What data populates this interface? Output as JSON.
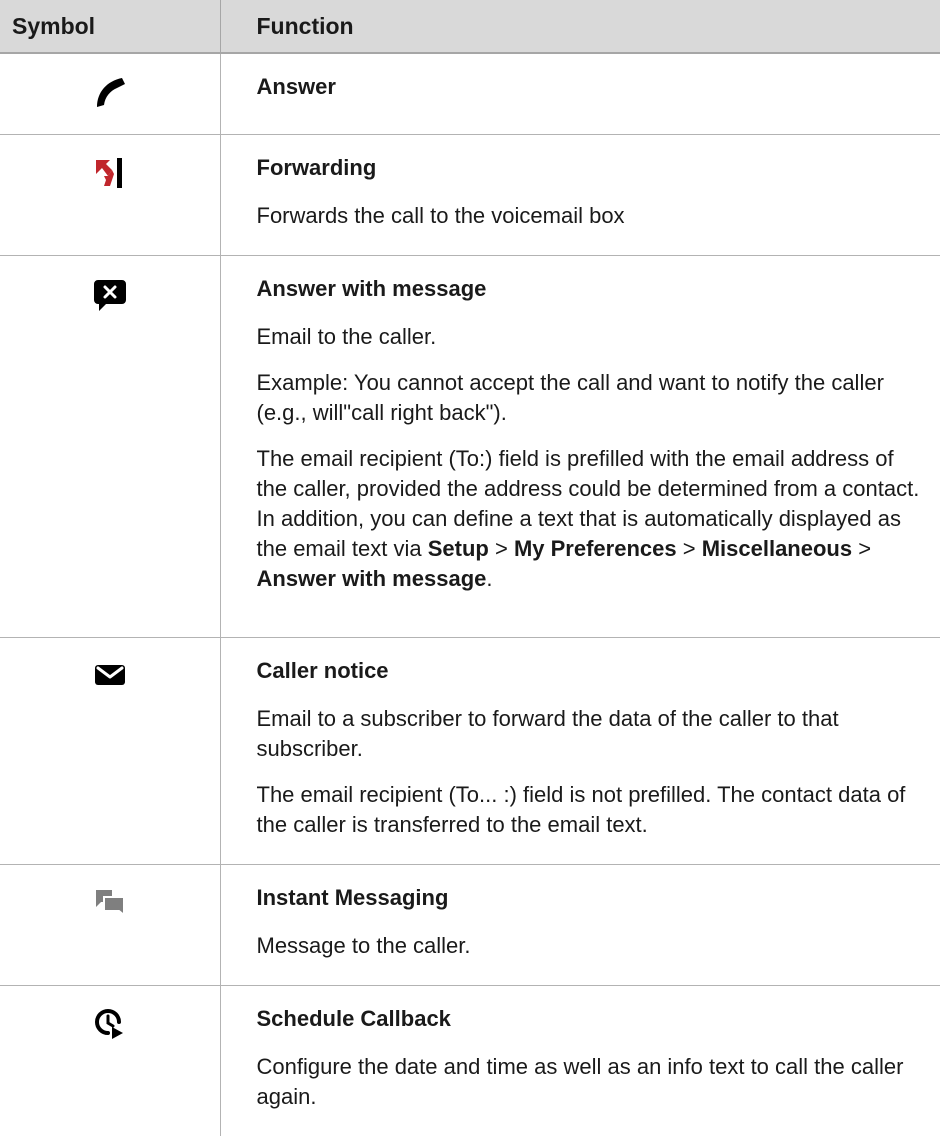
{
  "header": {
    "symbol": "Symbol",
    "function": "Function"
  },
  "rows": [
    {
      "icon": "phone-handset-icon",
      "title": "Answer"
    },
    {
      "icon": "forward-to-voicemail-icon",
      "title": "Forwarding",
      "p1": "Forwards the call to the voicemail box"
    },
    {
      "icon": "chat-bubble-x-icon",
      "title": "Answer with message",
      "p1": "Email to the caller.",
      "p2": "Example: You cannot accept the call and want to notify the caller (e.g., will\"call right back\").",
      "p3": "The email recipient (To:) field is prefilled with the email address of the caller, provided the address could be determined from a contact. In addition, you can define a text that is automatically displayed as the email text via",
      "menu": [
        "Setup",
        "My Preferences",
        "Miscellaneous",
        "Answer with message"
      ],
      "sep": ">",
      "end": "."
    },
    {
      "icon": "envelope-icon",
      "title": "Caller notice",
      "p1": "Email to a subscriber to forward the data of the caller to that subscriber.",
      "p2": "The email recipient (To... :) field is not prefilled. The contact data of the caller is transferred to the email text."
    },
    {
      "icon": "chat-bubbles-icon",
      "title": "Instant Messaging",
      "p1": "Message to the caller."
    },
    {
      "icon": "schedule-callback-icon",
      "title": "Schedule Callback",
      "p1": "Configure the date and time as well as an info text to call the caller again."
    }
  ],
  "colors": {
    "header_bg": "#d9d9d9",
    "forward_red": "#c0262c",
    "im_gray": "#7f7f7f"
  }
}
